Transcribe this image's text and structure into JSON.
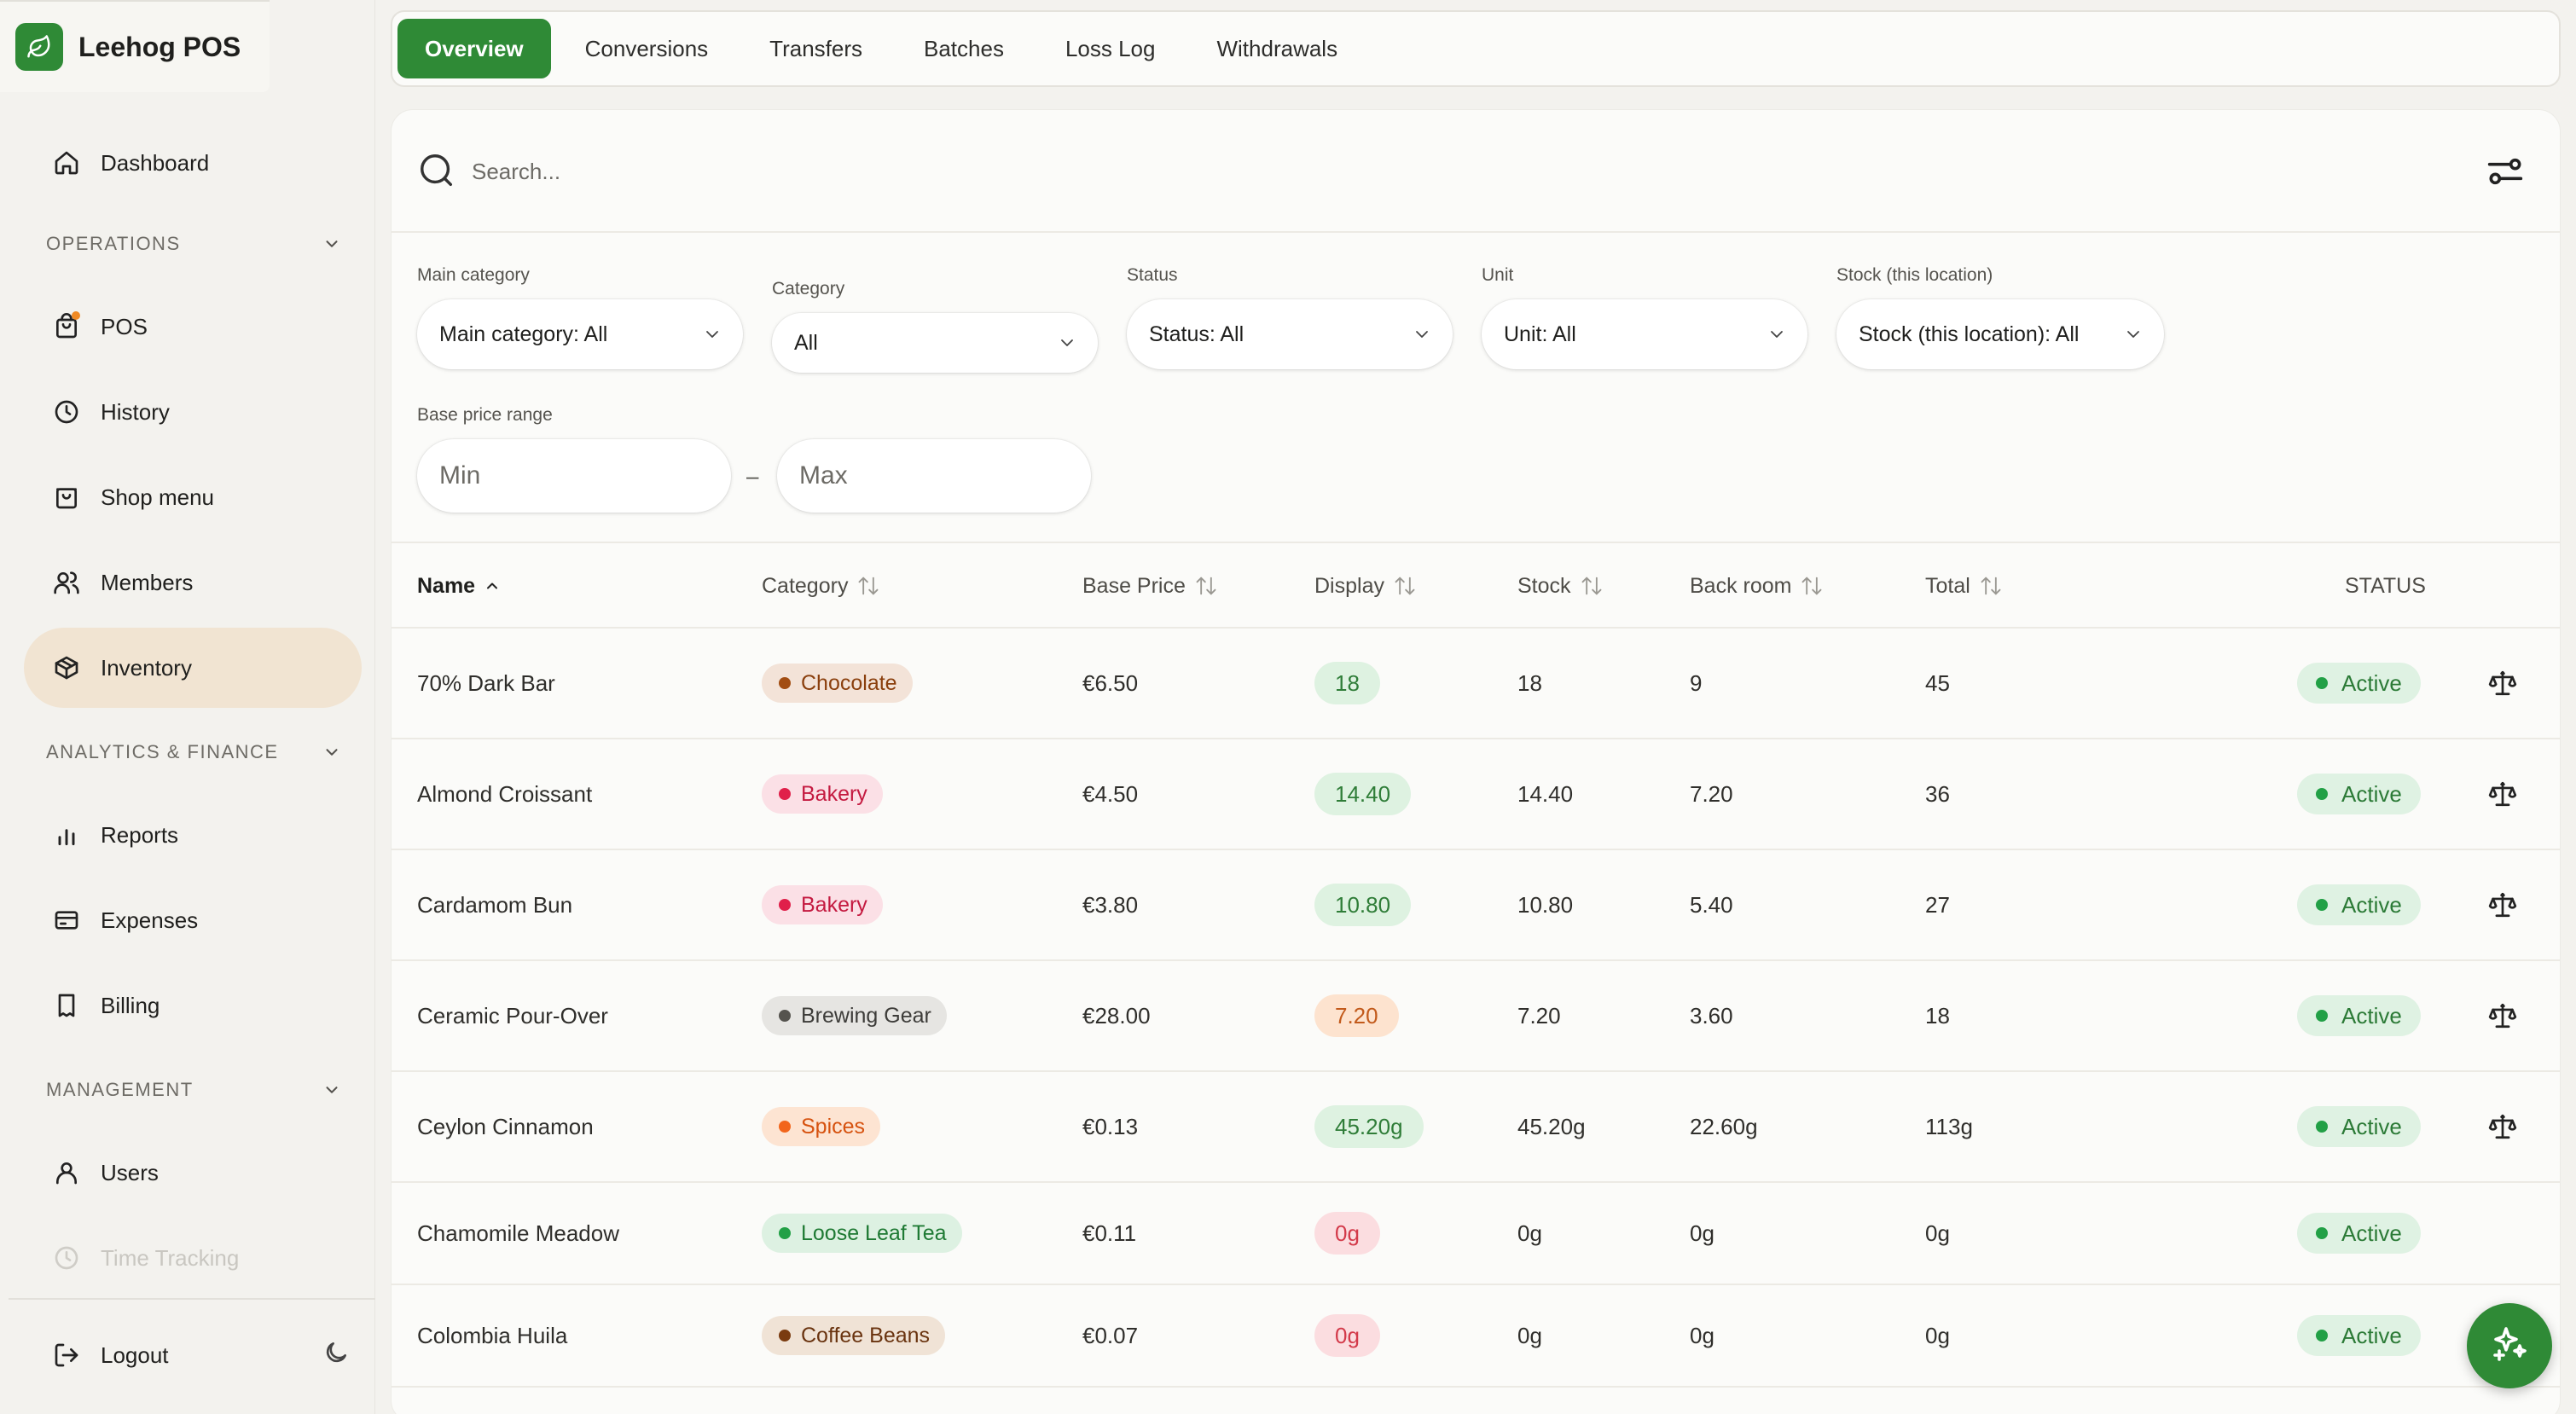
{
  "app": {
    "name": "Leehog POS"
  },
  "sidebar": {
    "dashboard": "Dashboard",
    "sections": {
      "operations": "OPERATIONS",
      "analytics": "ANALYTICS & FINANCE",
      "management": "MANAGEMENT"
    },
    "items": {
      "pos": "POS",
      "history": "History",
      "shop_menu": "Shop menu",
      "members": "Members",
      "inventory": "Inventory",
      "reports": "Reports",
      "expenses": "Expenses",
      "billing": "Billing",
      "users": "Users",
      "time_tracking": "Time Tracking"
    },
    "logout": "Logout"
  },
  "tabs": [
    "Overview",
    "Conversions",
    "Transfers",
    "Batches",
    "Loss Log",
    "Withdrawals"
  ],
  "search": {
    "placeholder": "Search..."
  },
  "filters": {
    "main_category": {
      "label": "Main category",
      "value": "Main category: All"
    },
    "category": {
      "label": "Category",
      "value": "All"
    },
    "status": {
      "label": "Status",
      "value": "Status: All"
    },
    "unit": {
      "label": "Unit",
      "value": "Unit: All"
    },
    "stock": {
      "label": "Stock (this location)",
      "value": "Stock (this location): All"
    },
    "price_range": {
      "label": "Base price range",
      "min_placeholder": "Min",
      "max_placeholder": "Max",
      "separator": "–"
    }
  },
  "table": {
    "columns": {
      "name": "Name",
      "category": "Category",
      "base_price": "Base Price",
      "display": "Display",
      "stock": "Stock",
      "back_room": "Back room",
      "total": "Total",
      "status": "STATUS"
    },
    "rows": [
      {
        "name": "70% Dark Bar",
        "category": "Chocolate",
        "cat_style": "brown",
        "base_price": "€6.50",
        "display": "18",
        "display_style": "green",
        "stock": "18",
        "back_room": "9",
        "total": "45",
        "status": "Active",
        "scale": true
      },
      {
        "name": "Almond Croissant",
        "category": "Bakery",
        "cat_style": "pink",
        "base_price": "€4.50",
        "display": "14.40",
        "display_style": "green",
        "stock": "14.40",
        "back_room": "7.20",
        "total": "36",
        "status": "Active",
        "scale": true
      },
      {
        "name": "Cardamom Bun",
        "category": "Bakery",
        "cat_style": "pink",
        "base_price": "€3.80",
        "display": "10.80",
        "display_style": "green",
        "stock": "10.80",
        "back_room": "5.40",
        "total": "27",
        "status": "Active",
        "scale": true
      },
      {
        "name": "Ceramic Pour-Over",
        "category": "Brewing Gear",
        "cat_style": "gray",
        "base_price": "€28.00",
        "display": "7.20",
        "display_style": "orange",
        "stock": "7.20",
        "back_room": "3.60",
        "total": "18",
        "status": "Active",
        "scale": true
      },
      {
        "name": "Ceylon Cinnamon",
        "category": "Spices",
        "cat_style": "orange",
        "base_price": "€0.13",
        "display": "45.20g",
        "display_style": "green",
        "stock": "45.20g",
        "back_room": "22.60g",
        "total": "113g",
        "status": "Active",
        "scale": true
      },
      {
        "name": "Chamomile Meadow",
        "category": "Loose Leaf Tea",
        "cat_style": "green",
        "base_price": "€0.11",
        "display": "0g",
        "display_style": "red",
        "stock": "0g",
        "back_room": "0g",
        "total": "0g",
        "status": "Active",
        "scale": false
      },
      {
        "name": "Colombia Huila",
        "category": "Coffee Beans",
        "cat_style": "coffee",
        "base_price": "€0.07",
        "display": "0g",
        "display_style": "red",
        "stock": "0g",
        "back_room": "0g",
        "total": "0g",
        "status": "Active",
        "scale": false
      }
    ]
  },
  "colors": {
    "brand_green": "#2f8a36",
    "active_nav_bg": "#f1e4d2",
    "status_active_bg": "#dff2e3",
    "notification_dot": "#f08a24",
    "categories": {
      "brown": {
        "bg": "#f3e3d8",
        "dot": "#a24d12",
        "text": "#8a3f0d"
      },
      "pink": {
        "bg": "#fbe0e6",
        "dot": "#e0204a",
        "text": "#c41a40"
      },
      "gray": {
        "bg": "#e6e5e2",
        "dot": "#55534e",
        "text": "#3d3c39"
      },
      "orange": {
        "bg": "#fde4d2",
        "dot": "#f2651b",
        "text": "#d6520f"
      },
      "green": {
        "bg": "#ddf1e2",
        "dot": "#22a046",
        "text": "#1f7a34"
      },
      "coffee": {
        "bg": "#f0e3d6",
        "dot": "#7a3b10",
        "text": "#6a3410"
      }
    }
  },
  "icons": {
    "brand": "leaf-icon",
    "dashboard": "home-icon",
    "pos": "shopping-bag-icon",
    "history": "clock-icon",
    "shop_menu": "shopping-bag-icon",
    "members": "users-icon",
    "inventory": "box-icon",
    "reports": "bar-chart-icon",
    "expenses": "credit-card-icon",
    "billing": "receipt-icon",
    "users": "user-icon",
    "time_tracking": "clock-icon",
    "logout": "logout-icon",
    "theme": "moon-icon",
    "search": "search-icon",
    "filters": "sliders-icon",
    "row_action": "scale-icon",
    "assistant": "sparkles-icon"
  }
}
